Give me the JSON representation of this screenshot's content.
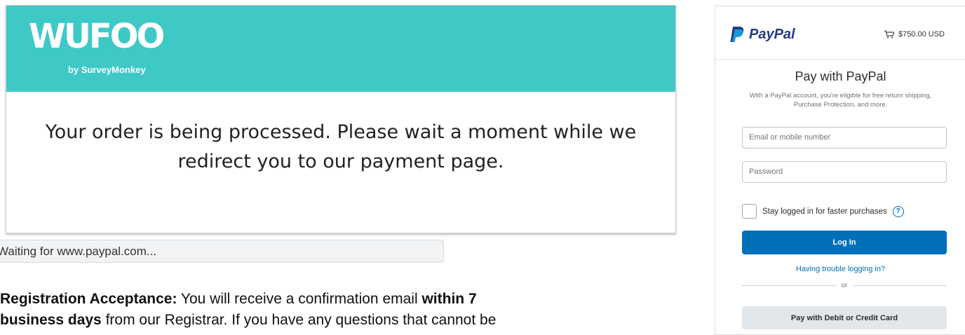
{
  "wufoo": {
    "logo_text": "WUFOO",
    "logo_sub": "by SurveyMonkey",
    "message_line1": "Your order is being processed. Please wait a moment while we",
    "message_line2": "redirect you to our payment page.",
    "header_color": "#3ec9c7"
  },
  "status_bar": {
    "text": "Waiting for www.paypal.com..."
  },
  "paragraph": {
    "label": "Registration Acceptance:",
    "text1": " You will receive a confirmation email ",
    "bold2": "within 7",
    "bold3": "business days",
    "text3": " from our Registrar. If you have any questions that cannot be"
  },
  "paypal": {
    "brand": "PayPal",
    "amount": "$750.00 USD",
    "title": "Pay with PayPal",
    "subtitle": "With a PayPal account, you're eligible for free return shipping, Purchase Protection, and more.",
    "email_placeholder": "Email or mobile number",
    "password_placeholder": "Password",
    "stay_logged_in": "Stay logged in for faster purchases",
    "help_symbol": "?",
    "login_button": "Log In",
    "trouble_link": "Having trouble logging in?",
    "or": "or",
    "card_button": "Pay with Debit or Credit Card",
    "accent_color": "#0070ba",
    "logo_icon": "paypal-p-icon",
    "cart_icon": "cart-icon"
  }
}
